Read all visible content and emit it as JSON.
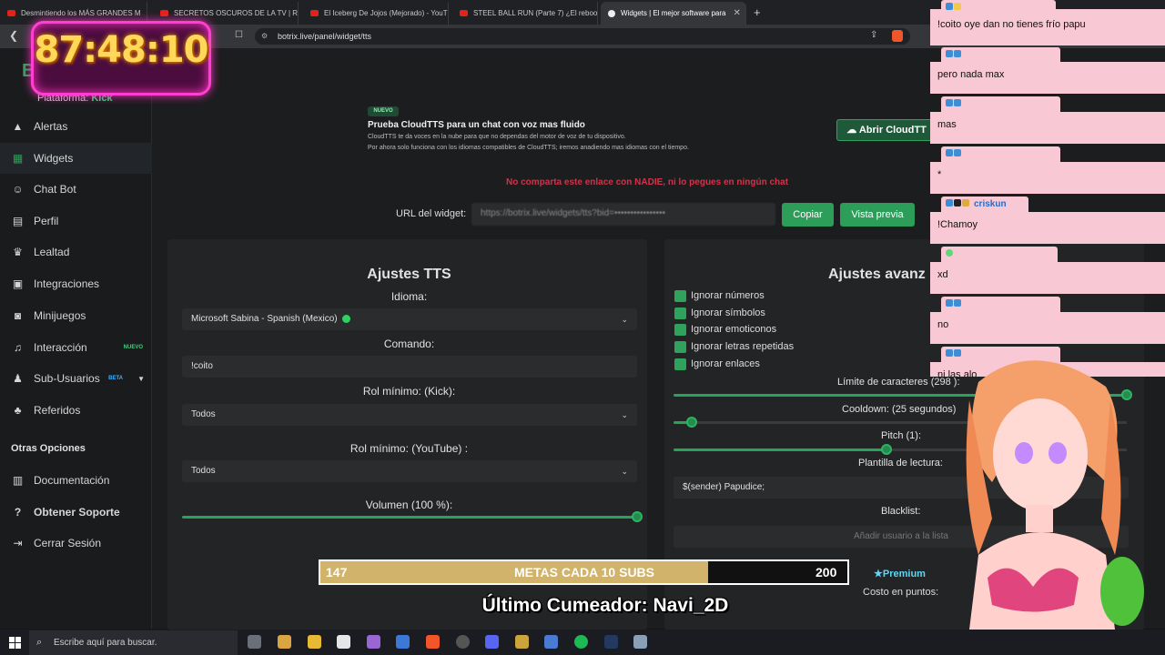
{
  "browser": {
    "tabs": [
      {
        "title": "Desmintiendo los MÁS GRANDES M"
      },
      {
        "title": "SECRETOS OSCUROS DE LA TV | REC"
      },
      {
        "title": "El Iceberg De Jojos (Mejorado) - YouT"
      },
      {
        "title": "STEEL BALL RUN (Parte 7) ¿El reboot"
      },
      {
        "title": "Widgets | El mejor software para"
      }
    ],
    "url": "botrix.live/panel/widget/tts"
  },
  "sidebar": {
    "platform_label": "Plataforma:",
    "platform_value": "Kick",
    "items": [
      {
        "label": "Alertas",
        "icon": "warning-icon"
      },
      {
        "label": "Widgets",
        "icon": "grid-icon"
      },
      {
        "label": "Chat Bot",
        "icon": "robot-icon"
      },
      {
        "label": "Perfil",
        "icon": "id-card-icon"
      },
      {
        "label": "Lealtad",
        "icon": "trophy-icon"
      },
      {
        "label": "Integraciones",
        "icon": "plug-icon"
      },
      {
        "label": "Minijuegos",
        "icon": "gamepad-icon"
      },
      {
        "label": "Interacción",
        "icon": "music-icon",
        "badge": "NUEVO"
      },
      {
        "label": "Sub-Usuarios",
        "icon": "users-icon",
        "badge": "BETA"
      },
      {
        "label": "Referidos",
        "icon": "referrals-icon"
      }
    ],
    "section_title": "Otras Opciones",
    "other_items": [
      {
        "label": "Documentación"
      },
      {
        "label": "Obtener Soporte"
      },
      {
        "label": "Cerrar Sesión"
      }
    ]
  },
  "banner": {
    "badge": "NUEVO",
    "title": "Prueba CloudTTS para un chat con voz mas fluido",
    "line1": "CloudTTS te da voces en la nube para que no dependas del motor de voz de tu dispositivo.",
    "line2": "Por ahora solo funciona con los idiomas compatibles de CloudTTS; iremos anadiendo mas idiomas con el tiempo.",
    "button": "Abrir CloudTT"
  },
  "warning": "No comparta este enlace con NADIE, ni lo pegues en ningún chat",
  "widget_url": {
    "label": "URL del widget:",
    "copy": "Copiar",
    "preview": "Vista previa"
  },
  "tts": {
    "title": "Ajustes TTS",
    "idioma_label": "Idioma:",
    "idioma_value": "Microsoft Sabina - Spanish (Mexico)",
    "comando_label": "Comando:",
    "comando_value": "!coito",
    "rol_kick_label": "Rol mínimo: (Kick):",
    "rol_kick_value": "Todos",
    "rol_yt_label": "Rol mínimo: (YouTube) :",
    "rol_yt_value": "Todos",
    "volumen_label": "Volumen (100 %):",
    "volumen_fraction": 1.0
  },
  "advanced": {
    "title": "Ajustes avanz",
    "checks": [
      "Ignorar números",
      "Ignorar símbolos",
      "Ignorar emoticonos",
      "Ignorar letras repetidas",
      "Ignorar enlaces"
    ],
    "limite_label": "Límite de caracteres (298 ):",
    "limite_fraction": 1.0,
    "cooldown_label": "Cooldown: (25 segundos)",
    "cooldown_fraction": 0.04,
    "pitch_label": "Pitch (1):",
    "pitch_fraction": 0.47,
    "plantilla_label": "Plantilla de lectura:",
    "plantilla_value": "$(sender) Papudice;",
    "blacklist_label": "Blacklist:",
    "blacklist_placeholder": "Añadir usuario a la lista",
    "premium": "Premium",
    "costo_label": "Costo en puntos:"
  },
  "overlay": {
    "timer": "87:48:10",
    "goal_current": "147",
    "goal_title": "METAS CADA 10 SUBS",
    "goal_target": "200",
    "goal_fraction": 0.735,
    "cumeador": "Último Cumeador: Navi_2D"
  },
  "chat": [
    {
      "message": "!coito oye dan no tienes frío papu"
    },
    {
      "message": "pero nada max"
    },
    {
      "message": "mas"
    },
    {
      "message": "*"
    },
    {
      "username": "criskun",
      "message": "!Chamoy"
    },
    {
      "message": "xd"
    },
    {
      "message": "no"
    },
    {
      "message": "ni las alo"
    }
  ],
  "taskbar": {
    "search_placeholder": "Escribe aquí para buscar."
  }
}
